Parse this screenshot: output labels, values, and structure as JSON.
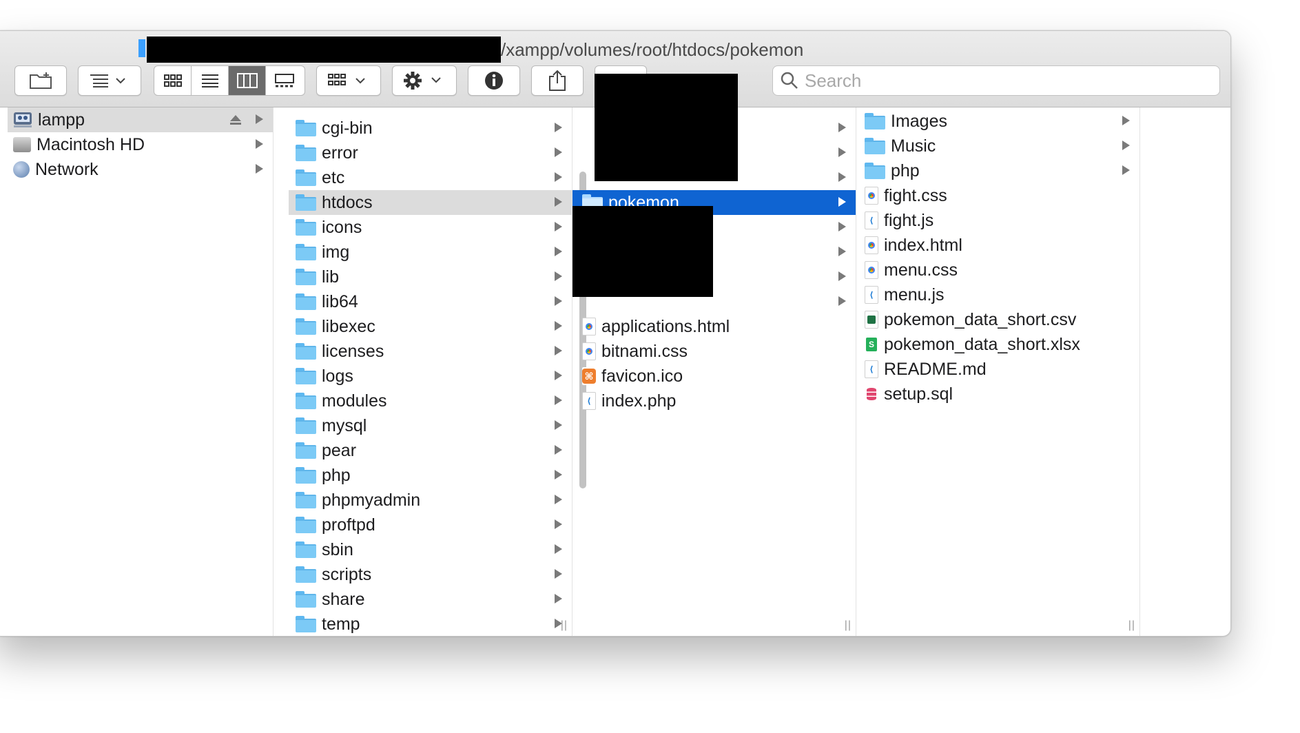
{
  "window": {
    "path_title": "/xampp/volumes/root/htdocs/pokemon"
  },
  "toolbar": {
    "search_placeholder": "Search",
    "buttons": [
      "new-folder",
      "group-by",
      "view-icons",
      "view-list",
      "view-columns",
      "view-gallery",
      "arrange",
      "action",
      "info",
      "share",
      "tags"
    ]
  },
  "sidebar": {
    "items": [
      {
        "label": "lampp",
        "icon": "server-icon",
        "eject": true,
        "selected": true
      },
      {
        "label": "Macintosh HD",
        "icon": "hard-drive-icon"
      },
      {
        "label": "Network",
        "icon": "network-icon"
      }
    ]
  },
  "column1": {
    "items": [
      {
        "label": "cgi-bin"
      },
      {
        "label": "error"
      },
      {
        "label": "etc"
      },
      {
        "label": "htdocs",
        "selected": true
      },
      {
        "label": "icons"
      },
      {
        "label": "img"
      },
      {
        "label": "lib"
      },
      {
        "label": "lib64"
      },
      {
        "label": "libexec"
      },
      {
        "label": "licenses"
      },
      {
        "label": "logs"
      },
      {
        "label": "modules"
      },
      {
        "label": "mysql"
      },
      {
        "label": "pear"
      },
      {
        "label": "php"
      },
      {
        "label": "phpmyadmin"
      },
      {
        "label": "proftpd"
      },
      {
        "label": "sbin"
      },
      {
        "label": "scripts"
      },
      {
        "label": "share"
      },
      {
        "label": "temp"
      }
    ]
  },
  "column2": {
    "selected_folder": "pokemon",
    "files": [
      {
        "label": "applications.html",
        "icon": "chrome-doc-icon"
      },
      {
        "label": "bitnami.css",
        "icon": "chrome-doc-icon"
      },
      {
        "label": "favicon.ico",
        "icon": "xampp-icon"
      },
      {
        "label": "index.php",
        "icon": "vscode-doc-icon"
      }
    ]
  },
  "column3": {
    "items": [
      {
        "label": "Images",
        "icon": "folder-icon",
        "folder": true
      },
      {
        "label": "Music",
        "icon": "folder-icon",
        "folder": true
      },
      {
        "label": "php",
        "icon": "folder-icon",
        "folder": true
      },
      {
        "label": "fight.css",
        "icon": "chrome-doc-icon"
      },
      {
        "label": "fight.js",
        "icon": "vscode-doc-icon"
      },
      {
        "label": "index.html",
        "icon": "chrome-doc-icon"
      },
      {
        "label": "menu.css",
        "icon": "chrome-doc-icon"
      },
      {
        "label": "menu.js",
        "icon": "vscode-doc-icon"
      },
      {
        "label": "pokemon_data_short.csv",
        "icon": "excel-doc-icon"
      },
      {
        "label": "pokemon_data_short.xlsx",
        "icon": "numbers-doc-icon"
      },
      {
        "label": "README.md",
        "icon": "vscode-doc-icon"
      },
      {
        "label": "setup.sql",
        "icon": "database-icon"
      }
    ]
  },
  "colors": {
    "selection_blue": "#0f64d2",
    "selection_gray": "#dcdcdc",
    "folder_blue": "#7ccaf6"
  }
}
